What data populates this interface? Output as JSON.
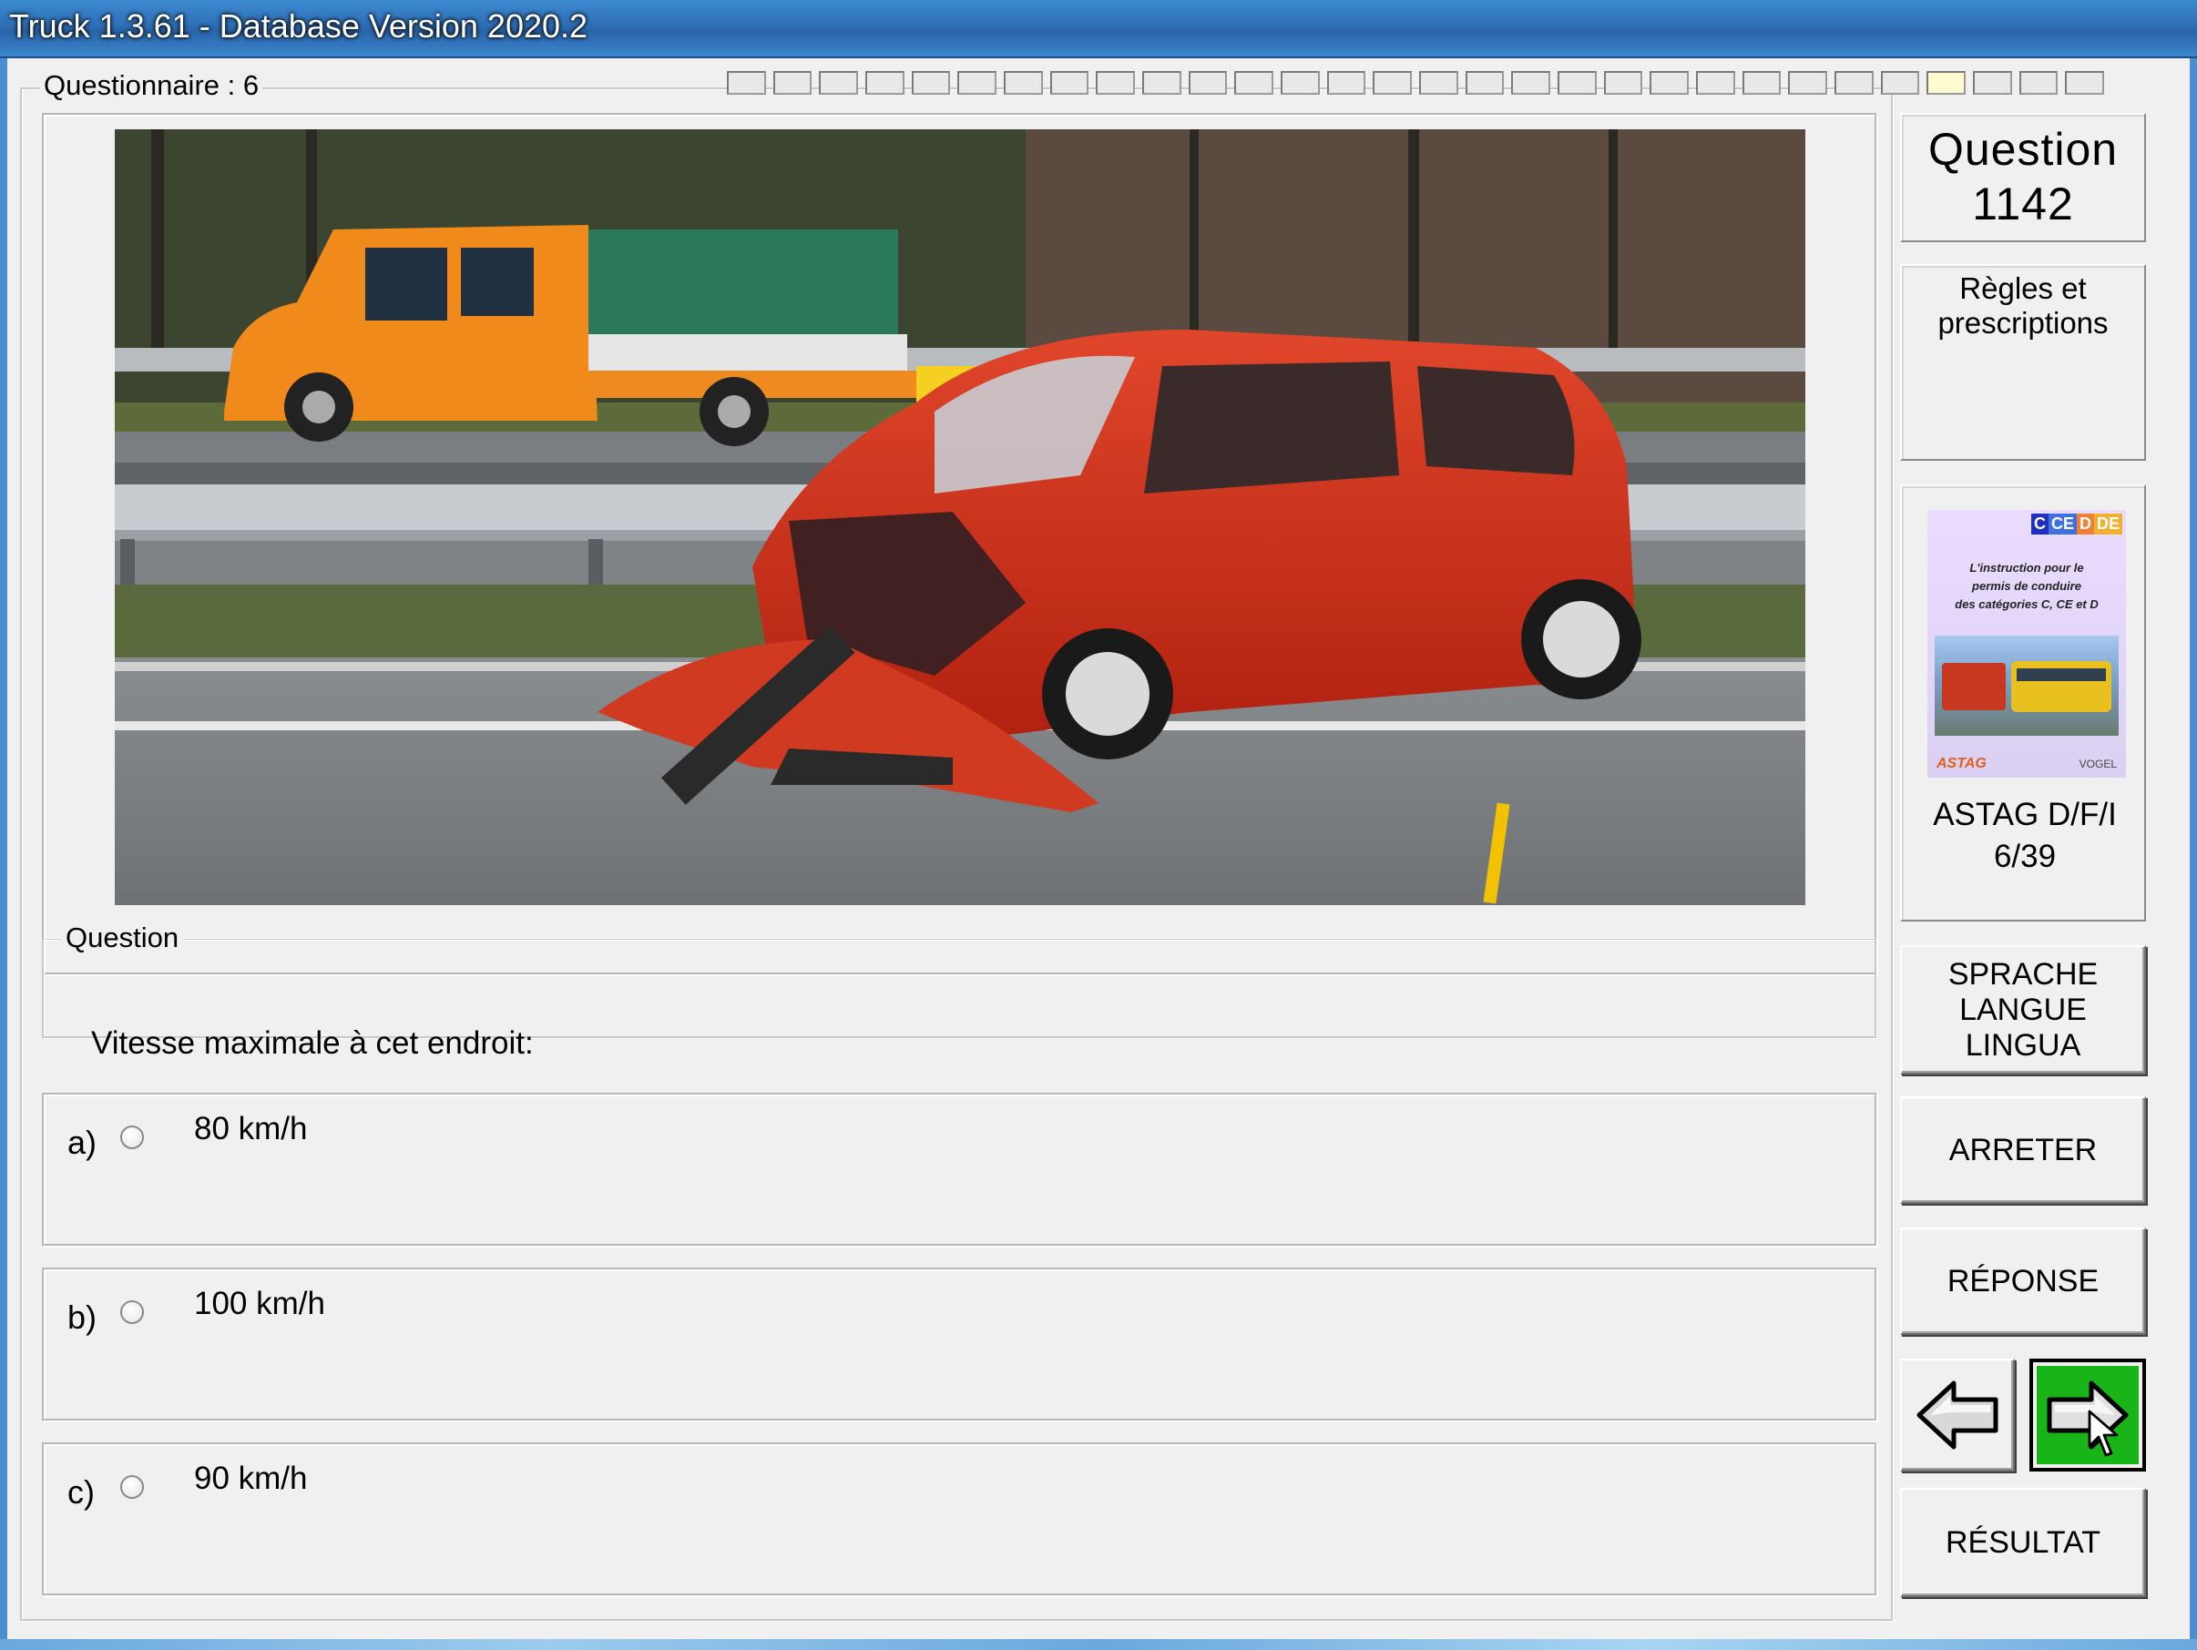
{
  "window": {
    "title": "Truck 1.3.61 - Database Version 2020.2"
  },
  "questionnaire": {
    "label": "Questionnaire : 6",
    "segments_total": 30,
    "current_segment": 27
  },
  "question_group_label": "Question",
  "question_text": "Vitesse maximale à cet endroit:",
  "answers": [
    {
      "letter": "a)",
      "text": "80 km/h"
    },
    {
      "letter": "b)",
      "text": "100 km/h"
    },
    {
      "letter": "c)",
      "text": "90 km/h"
    }
  ],
  "side": {
    "question_label": "Question",
    "question_number": "1142",
    "category_line1": "Règles et",
    "category_line2": "prescriptions",
    "book": {
      "badges": [
        "C",
        "CE",
        "D",
        "DE"
      ],
      "cover_line1": "L'instruction pour le",
      "cover_line2": "permis de conduire",
      "cover_line3": "des catégories C, CE et D",
      "publisher_left": "ASTAG",
      "publisher_right": "VOGEL",
      "source": "ASTAG D/F/I",
      "pages": "6/39"
    },
    "buttons": {
      "language_line1": "SPRACHE",
      "language_line2": "LANGUE",
      "language_line3": "LINGUA",
      "stop": "ARRETER",
      "answer": "RÉPONSE",
      "result": "RÉSULTAT"
    }
  },
  "colors": {
    "next_button": "#18b418",
    "titlebar": "#2e6fb6"
  }
}
